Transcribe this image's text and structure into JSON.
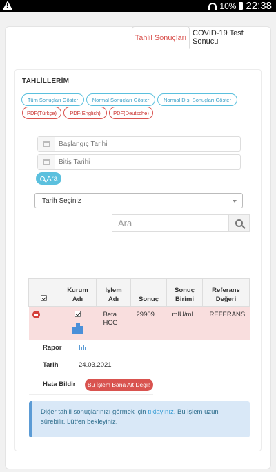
{
  "statusbar": {
    "battery": "10%",
    "time": "22:38",
    "warning_glyph": "!"
  },
  "tabs": [
    {
      "label": "Tahlil Sonuçları",
      "active": true
    },
    {
      "label": "COVID-19 Test Sonucu",
      "active": false
    }
  ],
  "section_title": "TAHLİLLERİM",
  "filters": {
    "all": "Tüm Sonuçları Göster",
    "normal": "Normal Sonuçları Göster",
    "abnormal": "Normal Dışı Sonuçları Göster",
    "pdf_tr": "PDF(Türkçe)",
    "pdf_en": "PDF(English)",
    "pdf_de": "PDF(Deutsche)"
  },
  "date_start": {
    "placeholder": "Başlangıç Tarihi"
  },
  "date_end": {
    "placeholder": "Bitiş Tarihi"
  },
  "search_button": "Ara",
  "date_select": "Tarih Seçiniz",
  "table_search": {
    "placeholder": "Ara"
  },
  "table": {
    "headers": {
      "institution": "Kurum\nAdı",
      "process": "İşlem\nAdı",
      "result": "Sonuç",
      "unit": "Sonuç\nBirimi",
      "reference": "Referans\nDeğeri"
    },
    "row": {
      "process": "Beta\nHCG",
      "result": "29909",
      "unit": "mIU/mL",
      "reference": "REFERANS"
    }
  },
  "details": {
    "report_label": "Rapor",
    "date_label": "Tarih",
    "date_value": "24.03.2021",
    "report_issue_label": "Hata Bildir",
    "report_issue_button": "Bu İşlem Bana Ait Değil!"
  },
  "info": {
    "text_before": "Diğer tahlil sonuçlarınızı görmek için ",
    "link": "tıklayınız.",
    "text_after": " Bu işlem uzun sürebilir. Lütfen bekleyiniz."
  },
  "colors": {
    "accent_blue": "#5bc0de",
    "danger": "#d9534f",
    "row_highlight": "#f9dede",
    "info_bg": "#d9e8f7"
  }
}
